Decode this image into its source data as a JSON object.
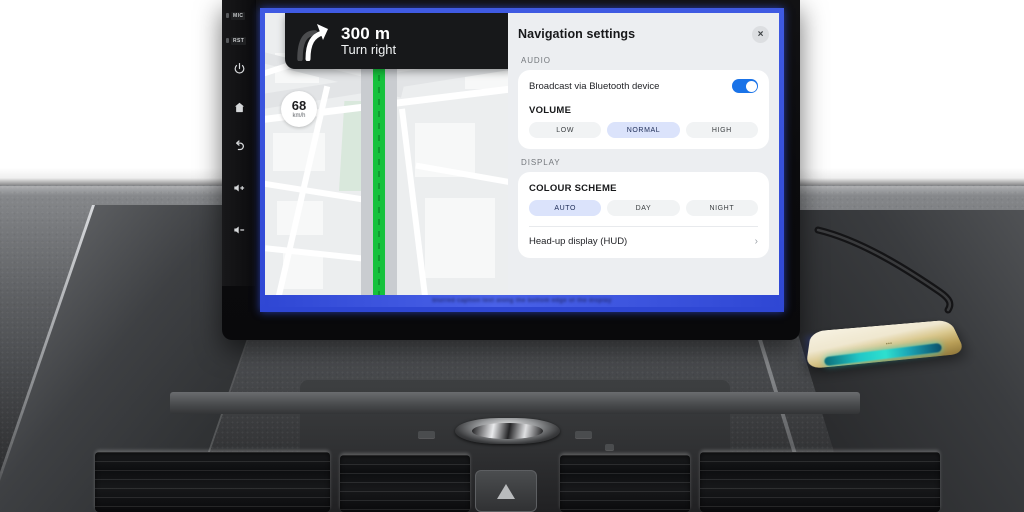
{
  "head_unit": {
    "side_buttons": [
      {
        "name": "mic-label",
        "label": "MIC"
      },
      {
        "name": "reset-label",
        "label": "RST"
      },
      {
        "name": "power-button",
        "label": "Power"
      },
      {
        "name": "home-button",
        "label": "Home"
      },
      {
        "name": "back-button",
        "label": "Back"
      },
      {
        "name": "volume-up-button",
        "label": "Volume up"
      },
      {
        "name": "volume-down-button",
        "label": "Volume down"
      }
    ]
  },
  "navigation": {
    "turn": {
      "distance": "300 m",
      "instruction": "Turn right",
      "icon": "turn-right-arrow-icon"
    },
    "speed": {
      "value": "68",
      "unit": "km/h"
    },
    "map": {
      "route_color": "#16c23c",
      "road_color": "#c9ccd0",
      "park_color": "#d9e8dc",
      "background_color": "#eceeef",
      "traffic_light_colors": [
        "#d93025",
        "#f9ab00",
        "#1e8e3e"
      ]
    }
  },
  "settings": {
    "title": "Navigation settings",
    "close_label": "×",
    "sections": [
      {
        "label": "AUDIO",
        "toggle": {
          "label": "Broadcast via Bluetooth device",
          "state": "on",
          "color": "#1a73e8"
        },
        "group_title": "VOLUME",
        "options": [
          "LOW",
          "NORMAL",
          "HIGH"
        ],
        "selected": "NORMAL"
      },
      {
        "label": "DISPLAY",
        "group_title": "COLOUR SCHEME",
        "options": [
          "AUTO",
          "DAY",
          "NIGHT"
        ],
        "selected": "AUTO",
        "link": {
          "label": "Head-up display (HUD)",
          "chevron": "›"
        }
      }
    ],
    "accent_active": "#dbe3fb",
    "accent_inactive": "#f1f3f4"
  },
  "caption": {
    "text": "blurred caption text along the bottom edge of the display"
  },
  "device": {
    "name": "android-media-box",
    "led_color": "#2ee0cf",
    "body_color": "#efe7cf"
  },
  "screen_border_color": "#3f5ae2"
}
